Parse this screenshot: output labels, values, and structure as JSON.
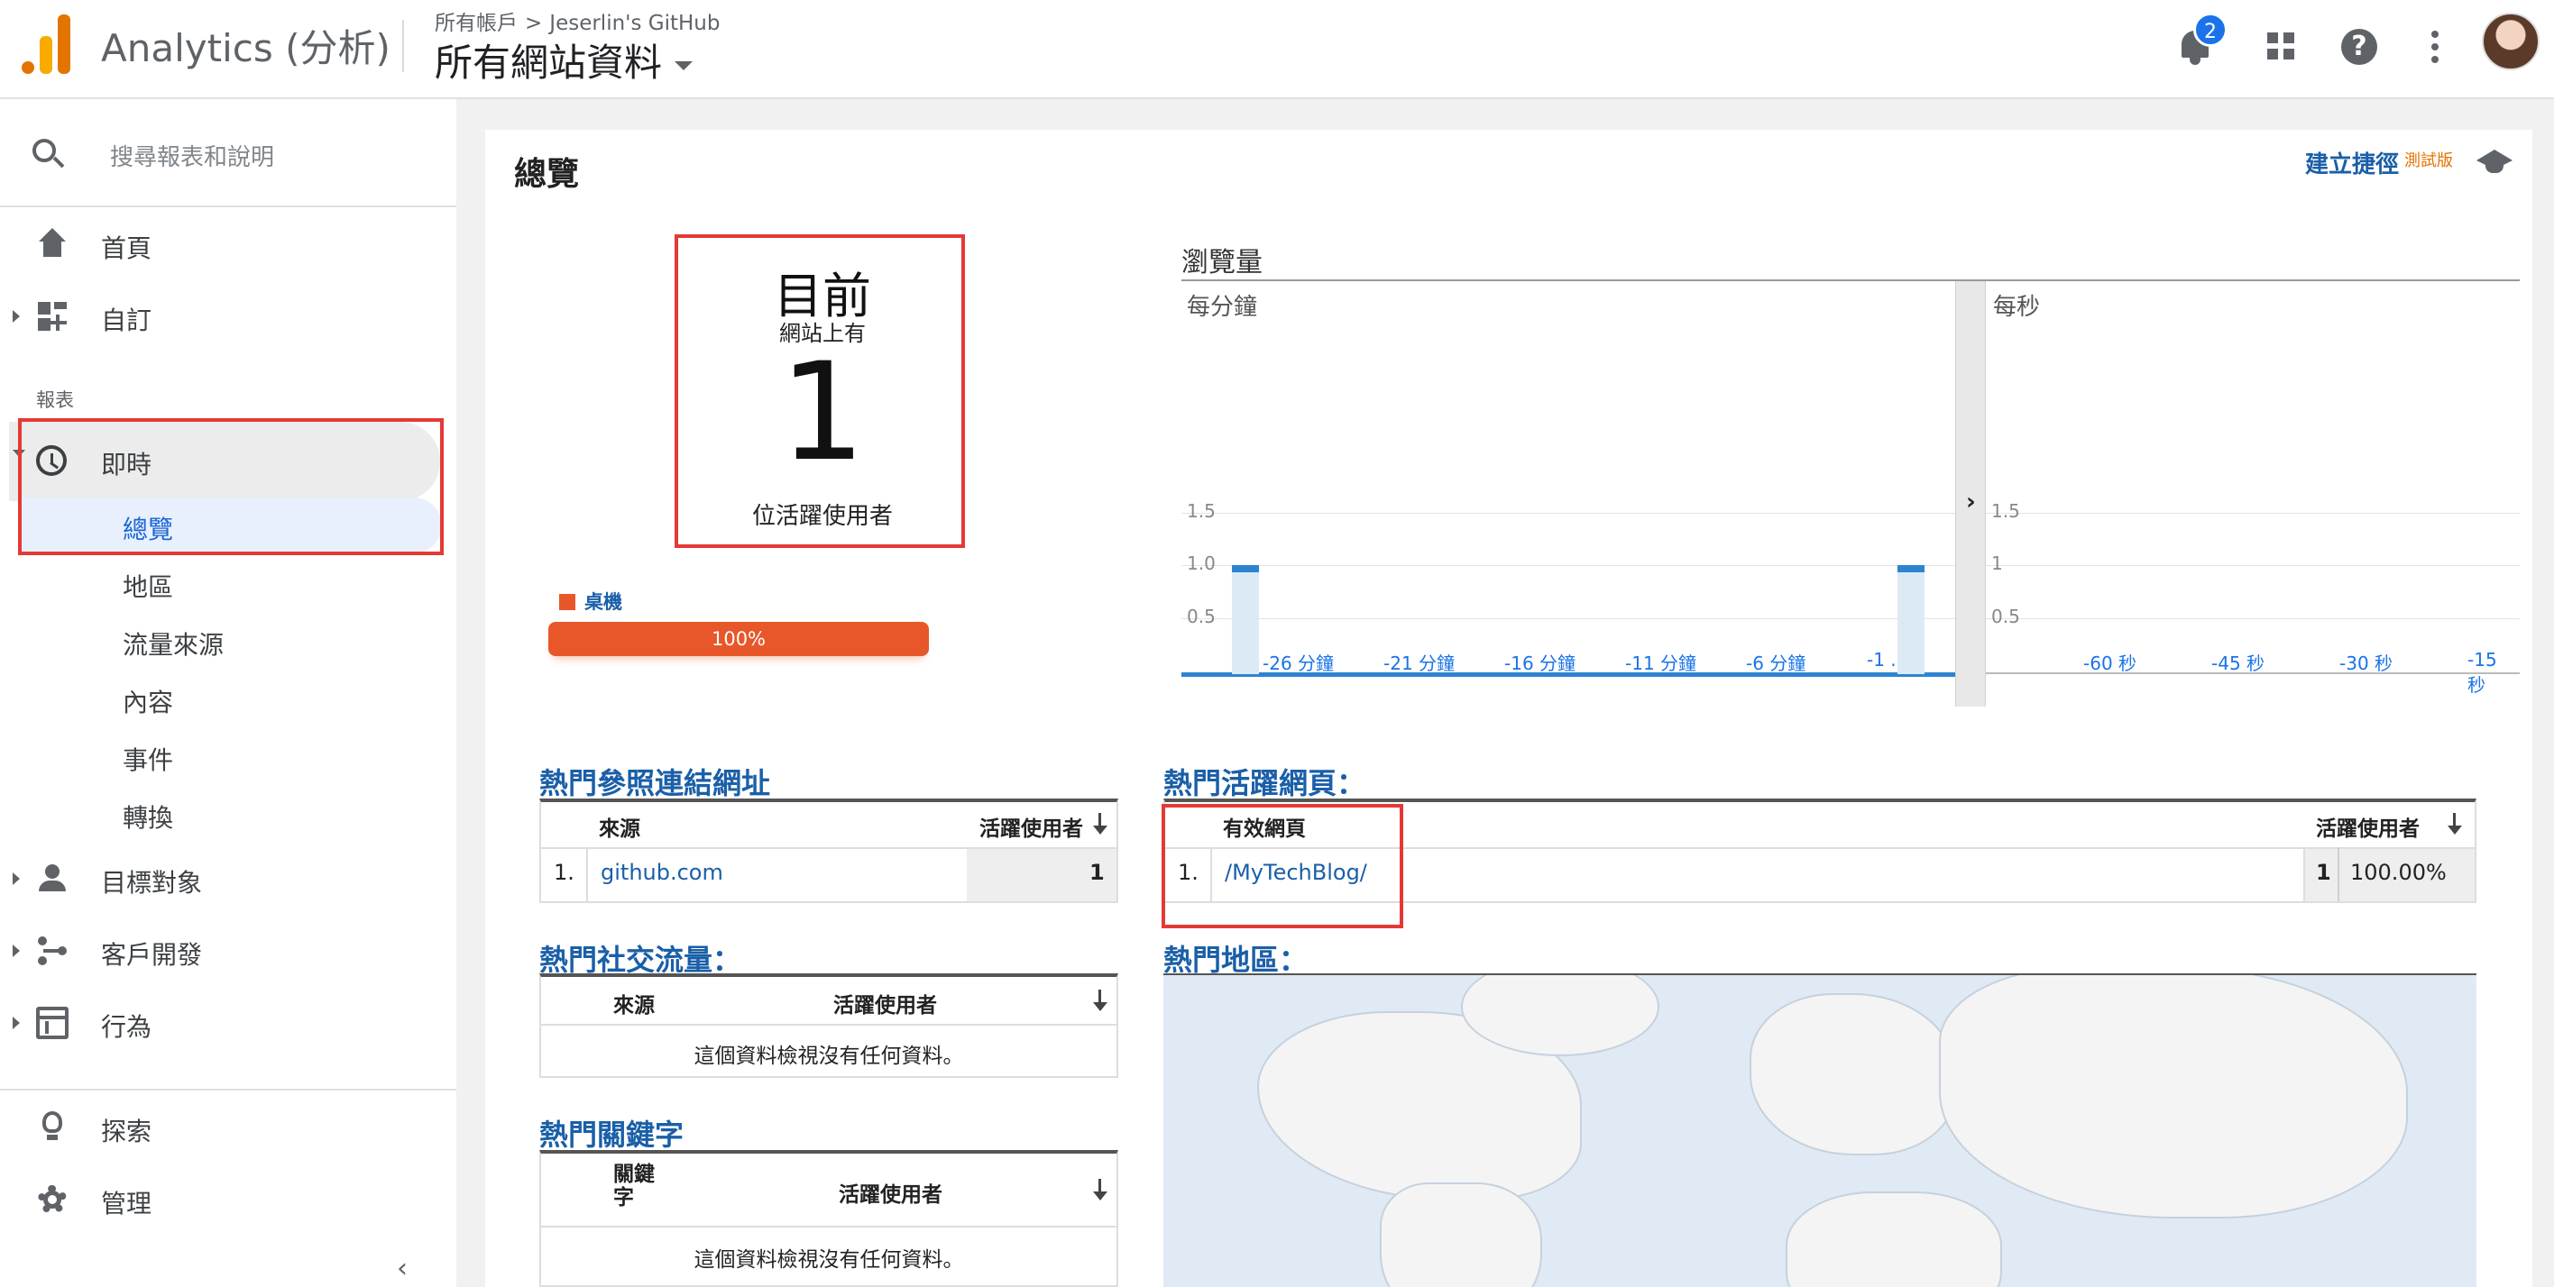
{
  "header": {
    "app_title": "Analytics (分析)",
    "breadcrumb": [
      "所有帳戶",
      "Jeserlin's GitHub"
    ],
    "breadcrumb_separator": ">",
    "property_name": "所有網站資料",
    "notification_count": "2"
  },
  "sidebar": {
    "search_placeholder": "搜尋報表和說明",
    "items": [
      {
        "label": "首頁",
        "icon": "home-icon"
      },
      {
        "label": "自訂",
        "icon": "dashboard-icon"
      }
    ],
    "reports_label": "報表",
    "realtime": {
      "label": "即時",
      "icon": "clock-icon",
      "sub_items": [
        "總覽",
        "地區",
        "流量來源",
        "內容",
        "事件",
        "轉換"
      ],
      "active_sub_item": "總覽"
    },
    "more_items": [
      {
        "label": "目標對象",
        "icon": "person-icon"
      },
      {
        "label": "客戶開發",
        "icon": "acquisition-icon"
      },
      {
        "label": "行為",
        "icon": "behavior-icon"
      }
    ],
    "bottom_items": [
      {
        "label": "探索",
        "icon": "lightbulb-icon"
      },
      {
        "label": "管理",
        "icon": "gear-icon"
      }
    ]
  },
  "main": {
    "title": "總覽",
    "create_shortcut": "建立捷徑",
    "beta_label": "測試版",
    "active_users": {
      "heading": "目前",
      "subheading": "網站上有",
      "count": "1",
      "caption": "位活躍使用者"
    },
    "device": {
      "legend": "桌機",
      "percent_label": "100%",
      "share": 1.0,
      "color": "#e8572a"
    },
    "pageviews": {
      "title": "瀏覽量",
      "per_minute_label": "每分鐘",
      "per_second_label": "每秒"
    },
    "top_referrals": {
      "title": "熱門參照連結網址",
      "col_source": "來源",
      "col_users": "活躍使用者",
      "rows": [
        {
          "rank": "1.",
          "source": "github.com",
          "users": "1"
        }
      ]
    },
    "top_active_pages": {
      "title": "熱門活躍網頁：",
      "col_page": "有效網頁",
      "col_users": "活躍使用者",
      "rows": [
        {
          "rank": "1.",
          "page": "/MyTechBlog/",
          "users": "1",
          "percent": "100.00%"
        }
      ]
    },
    "top_social": {
      "title": "熱門社交流量：",
      "col_source": "來源",
      "col_users": "活躍使用者",
      "empty_message": "這個資料檢視沒有任何資料。"
    },
    "top_locations": {
      "title": "熱門地區："
    },
    "top_keywords": {
      "title": "熱門關鍵字",
      "col_keyword": "關鍵字",
      "col_users": "活躍使用者",
      "empty_message": "這個資料檢視沒有任何資料。"
    }
  },
  "chart_data": [
    {
      "type": "bar",
      "title": "瀏覽量",
      "subtitle": "每分鐘",
      "x_tick_labels": [
        "-26 分鐘",
        "-21 分鐘",
        "-16 分鐘",
        "-11 分鐘",
        "-6 分鐘",
        "-1 ..."
      ],
      "y_tick_labels": [
        "0.5",
        "1.0",
        "1.5"
      ],
      "ylim": [
        0,
        2
      ],
      "x": [
        -30,
        -1
      ],
      "values": [
        1,
        1
      ],
      "bar_color": "#2c84d0"
    },
    {
      "type": "bar",
      "subtitle": "每秒",
      "x_tick_labels": [
        "-60 秒",
        "-45 秒",
        "-30 秒",
        "-15 秒"
      ],
      "y_tick_labels": [
        "0.5",
        "1",
        "1.5"
      ],
      "ylim": [
        0,
        2
      ],
      "values": []
    }
  ]
}
